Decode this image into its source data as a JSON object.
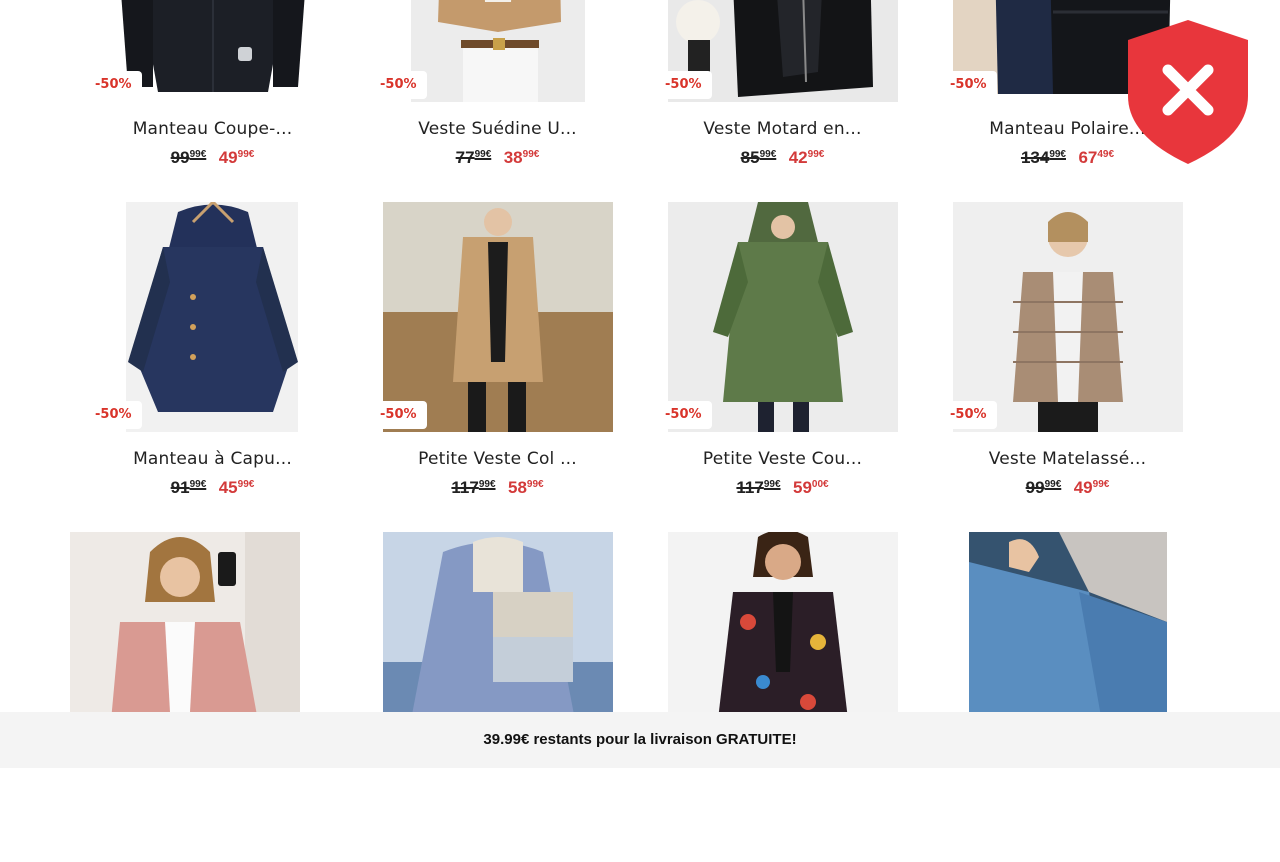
{
  "products": [
    {
      "title": "Manteau Coupe-...",
      "badge": "-50%",
      "old_int": "99",
      "old_dec": "99€",
      "new_int": "49",
      "new_dec": "99€",
      "img": "black-coat"
    },
    {
      "title": "Veste Suédine U...",
      "badge": "-50%",
      "old_int": "77",
      "old_dec": "99€",
      "new_int": "38",
      "new_dec": "99€",
      "img": "tan-suede"
    },
    {
      "title": "Veste Motard en...",
      "badge": "-50%",
      "old_int": "85",
      "old_dec": "99€",
      "new_int": "42",
      "new_dec": "99€",
      "img": "leather-biker"
    },
    {
      "title": "Manteau Polaire...",
      "badge": "-50%",
      "old_int": "134",
      "old_dec": "99€",
      "new_int": "67",
      "new_dec": "49€",
      "img": "puffer-black"
    },
    {
      "title": "Manteau à Capu...",
      "badge": "-50%",
      "old_int": "91",
      "old_dec": "99€",
      "new_int": "45",
      "new_dec": "99€",
      "img": "navy-hood"
    },
    {
      "title": "Petite Veste Col ...",
      "badge": "-50%",
      "old_int": "117",
      "old_dec": "99€",
      "new_int": "58",
      "new_dec": "99€",
      "img": "camel-coat"
    },
    {
      "title": "Petite Veste Cou...",
      "badge": "-50%",
      "old_int": "117",
      "old_dec": "99€",
      "new_int": "59",
      "new_dec": "00€",
      "img": "green-parka"
    },
    {
      "title": "Veste Matelassé...",
      "badge": "-50%",
      "old_int": "99",
      "old_dec": "99€",
      "new_int": "49",
      "new_dec": "99€",
      "img": "beige-puffer"
    },
    {
      "title": "",
      "badge": "",
      "old_int": "",
      "old_dec": "",
      "new_int": "",
      "new_dec": "",
      "img": "pink-blazer"
    },
    {
      "title": "",
      "badge": "",
      "old_int": "",
      "old_dec": "",
      "new_int": "",
      "new_dec": "",
      "img": "blue-fleece"
    },
    {
      "title": "",
      "badge": "",
      "old_int": "",
      "old_dec": "",
      "new_int": "",
      "new_dec": "",
      "img": "floral-jacket"
    },
    {
      "title": "",
      "badge": "",
      "old_int": "",
      "old_dec": "",
      "new_int": "",
      "new_dec": "",
      "img": "denim-jacket"
    }
  ],
  "shipping_bar": {
    "text": "39.99€ restants pour la livraison GRATUITE!"
  },
  "colors": {
    "sale_red": "#d33a3a",
    "badge_red": "#d9342b",
    "shield_red": "#e8363c"
  },
  "icons": {
    "shield": "shield-x-icon"
  }
}
